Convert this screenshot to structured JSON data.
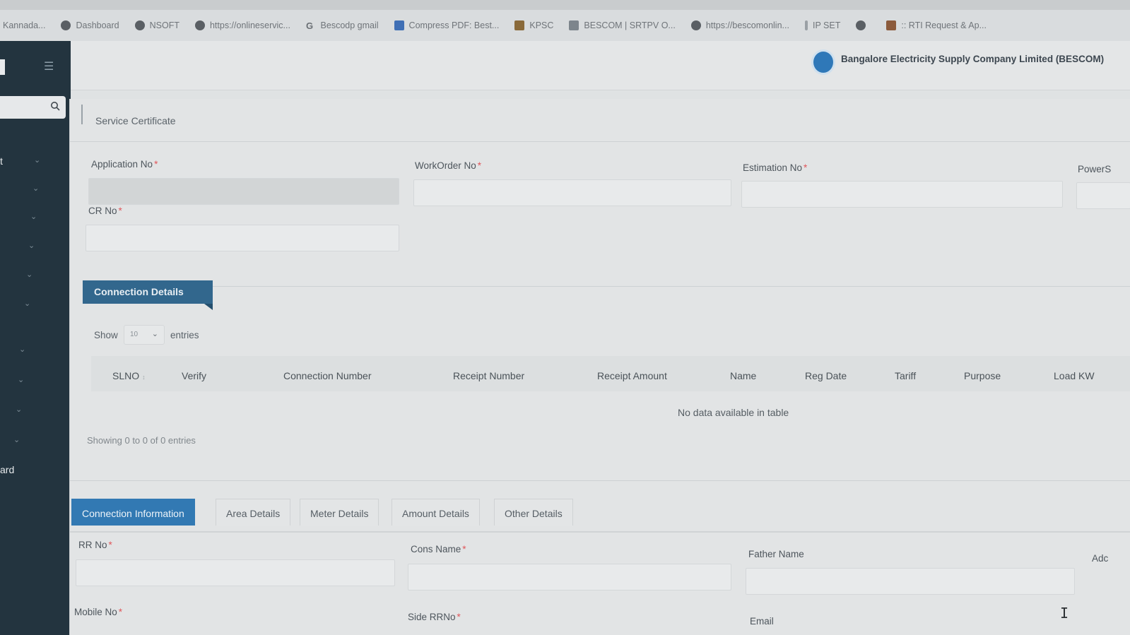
{
  "bookmarks": [
    {
      "label": "Kannada...",
      "icon": "none"
    },
    {
      "label": "Dashboard",
      "icon": "globe-icon"
    },
    {
      "label": "NSOFT",
      "icon": "globe-icon"
    },
    {
      "label": "https://onlineservic...",
      "icon": "globe-icon"
    },
    {
      "label": "Bescodp gmail",
      "icon": "google-icon"
    },
    {
      "label": "Compress PDF: Best...",
      "icon": "pdf-icon"
    },
    {
      "label": "KPSC",
      "icon": "kpsc-icon"
    },
    {
      "label": "BESCOM | SRTPV O...",
      "icon": "bescom-icon"
    },
    {
      "label": "https://bescomonlin...",
      "icon": "globe-icon"
    },
    {
      "label": "IP SET",
      "icon": "page-icon"
    },
    {
      "label": "",
      "icon": "globe-icon"
    },
    {
      "label": ":: RTI Request & Ap...",
      "icon": "rti-icon"
    }
  ],
  "sidebar": {
    "items": [
      {
        "label": "t",
        "chevron": "⌄"
      },
      {
        "label": "",
        "chevron": "⌄"
      },
      {
        "label": "",
        "chevron": "⌄"
      },
      {
        "label": "",
        "chevron": "⌄"
      },
      {
        "label": "",
        "chevron": "⌄"
      },
      {
        "label": "",
        "chevron": "⌄"
      },
      {
        "label": "",
        "chevron": "⌄"
      },
      {
        "label": "",
        "chevron": "⌄"
      },
      {
        "label": "",
        "chevron": "⌄"
      },
      {
        "label": "",
        "chevron": "⌄"
      },
      {
        "label": "ard",
        "chevron": ""
      }
    ]
  },
  "header": {
    "brand_name": "Bangalore Electricity Supply Company Limited (BESCOM)"
  },
  "page": {
    "title": "Service Certificate"
  },
  "form": {
    "application_no": {
      "label": "Application No",
      "required": "*",
      "value": ""
    },
    "workorder_no": {
      "label": "WorkOrder No",
      "required": "*",
      "value": ""
    },
    "estimation_no": {
      "label": "Estimation No",
      "required": "*",
      "value": ""
    },
    "power": {
      "label": "PowerS",
      "value": ""
    },
    "cr_no": {
      "label": "CR No",
      "required": "*",
      "value": ""
    }
  },
  "connection_details": {
    "section_title": "Connection Details",
    "show_label": "Show",
    "page_size": "10",
    "entries_label": "entries",
    "columns": [
      "SLNO",
      "Verify",
      "Connection Number",
      "Receipt Number",
      "Receipt Amount",
      "Name",
      "Reg Date",
      "Tariff",
      "Purpose",
      "Load KW"
    ],
    "empty_message": "No data available in table",
    "info": "Showing 0 to 0 of 0 entries"
  },
  "tabs": [
    {
      "label": "Connection Information",
      "active": true
    },
    {
      "label": "Area Details",
      "active": false
    },
    {
      "label": "Meter Details",
      "active": false
    },
    {
      "label": "Amount Details",
      "active": false
    },
    {
      "label": "Other Details",
      "active": false
    }
  ],
  "connection_info": {
    "rr_no": {
      "label": "RR No",
      "required": "*"
    },
    "cons_name": {
      "label": "Cons Name",
      "required": "*"
    },
    "father_name": {
      "label": "Father Name"
    },
    "address": {
      "label": "Adc"
    },
    "mobile_no": {
      "label": "Mobile No",
      "required": "*"
    },
    "side_rrno": {
      "label": "Side RRNo",
      "required": "*"
    },
    "email": {
      "label": "Email"
    }
  },
  "colors": {
    "sidebar": "#23343f",
    "section_tag": "#32678d",
    "active_tab": "#3279b3",
    "required_mark": "#e0565a"
  }
}
